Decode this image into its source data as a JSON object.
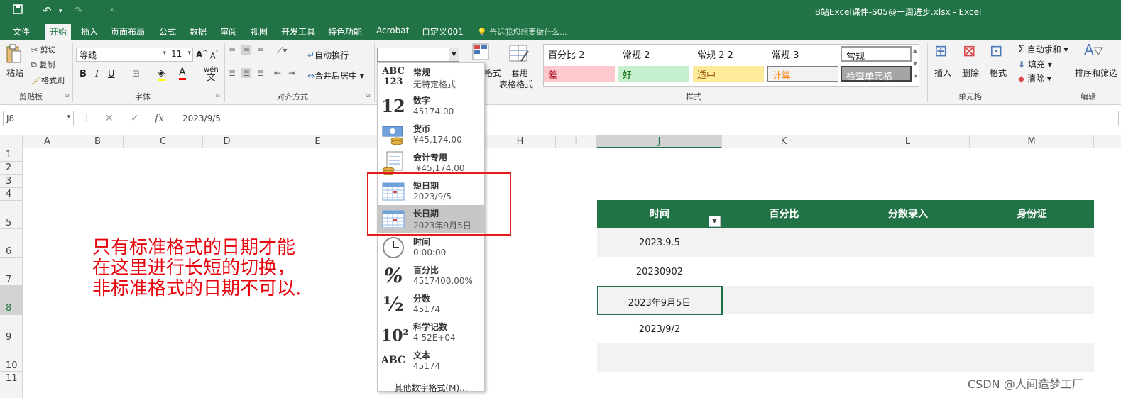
{
  "window": {
    "title": "B站Excel课件-S05@一周进步.xlsx - Excel"
  },
  "quick_access": {
    "save_icon": "save-icon",
    "undo_icon": "undo-icon",
    "redo_icon": "redo-icon",
    "customize_icon": "customize-icon"
  },
  "tabs": [
    "文件",
    "开始",
    "插入",
    "页面布局",
    "公式",
    "数据",
    "审阅",
    "视图",
    "开发工具",
    "特色功能",
    "Acrobat",
    "自定义001"
  ],
  "active_tab": "开始",
  "tell_me": "告诉我您想要做什么...",
  "clipboard": {
    "paste": "粘贴",
    "cut": "剪切",
    "copy": "复制",
    "format_painter": "格式刷",
    "label": "剪贴板"
  },
  "font": {
    "name": "等线",
    "size": "11",
    "bold": "B",
    "italic": "I",
    "underline": "U",
    "label": "字体",
    "phonetic": "wén"
  },
  "alignment": {
    "wrap": "自动换行",
    "merge": "合并后居中",
    "label": "对齐方式"
  },
  "number_format_combo": {
    "value": ""
  },
  "styles": {
    "conditional_partial": "格式",
    "table_format": [
      "套用",
      "表格格式"
    ],
    "items": [
      {
        "label": "百分比 2",
        "bg": "#ffffff",
        "fg": "#222222"
      },
      {
        "label": "常规 2",
        "bg": "#ffffff",
        "fg": "#222222"
      },
      {
        "label": "常规 2 2",
        "bg": "#ffffff",
        "fg": "#222222"
      },
      {
        "label": "常规 3",
        "bg": "#ffffff",
        "fg": "#222222"
      },
      {
        "label": "常规",
        "bg": "#ffffff",
        "fg": "#222222"
      },
      {
        "label": "差",
        "bg": "#ffc7ce",
        "fg": "#9c0006"
      },
      {
        "label": "好",
        "bg": "#c6efce",
        "fg": "#006100"
      },
      {
        "label": "适中",
        "bg": "#ffeb9c",
        "fg": "#9c5700"
      },
      {
        "label": "计算",
        "bg": "#f2f2f2",
        "fg": "#fa7d00"
      },
      {
        "label": "检查单元格",
        "bg": "#a5a5a5",
        "fg": "#ffffff"
      }
    ],
    "label": "样式"
  },
  "cells_group": {
    "insert": "插入",
    "delete": "删除",
    "format": "格式",
    "label": "单元格"
  },
  "editing": {
    "autosum": "自动求和",
    "fill": "填充",
    "clear": "清除",
    "sort": "排序和筛选",
    "label": "编辑"
  },
  "formula_bar": {
    "name_box": "J8",
    "formula": "2023/9/5"
  },
  "columns": [
    "A",
    "B",
    "C",
    "D",
    "E",
    "H",
    "I",
    "J",
    "K",
    "L",
    "M"
  ],
  "rows": [
    "1",
    "2",
    "3",
    "4",
    "5",
    "6",
    "7",
    "8",
    "9",
    "10",
    "11"
  ],
  "table": {
    "headers": [
      "时间",
      "百分比",
      "分数录入",
      "身份证"
    ],
    "values": [
      "2023.9.5",
      "20230902",
      "2023年9月5日",
      "2023/9/2",
      ""
    ]
  },
  "note": [
    "只有标准格式的日期才能",
    "在这里进行长短的切换，",
    "非标准格式的日期不可以."
  ],
  "dropdown": {
    "items": [
      {
        "icon": "ABC\n123",
        "name": "常规",
        "value": "无特定格式"
      },
      {
        "icon": "12",
        "name": "数字",
        "value": "45174.00"
      },
      {
        "icon": "currency-icon",
        "name": "货币",
        "value": "¥45,174.00"
      },
      {
        "icon": "accounting-icon",
        "name": "会计专用",
        "value": " ¥45,174.00"
      },
      {
        "icon": "calendar-icon",
        "name": "短日期",
        "value": "2023/9/5"
      },
      {
        "icon": "calendar-icon",
        "name": "长日期",
        "value": "2023年9月5日"
      },
      {
        "icon": "clock-icon",
        "name": "时间",
        "value": "0:00:00"
      },
      {
        "icon": "%",
        "name": "百分比",
        "value": "4517400.00%"
      },
      {
        "icon": "½",
        "name": "分数",
        "value": "45174"
      },
      {
        "icon": "10²",
        "name": "科学记数",
        "value": "4.52E+04"
      },
      {
        "icon": "ABC",
        "name": "文本",
        "value": "45174"
      }
    ],
    "more": "其他数字格式(M)...",
    "highlighted": "长日期"
  },
  "watermark": "CSDN @人间造梦工厂",
  "colors": {
    "excel_green": "#217346",
    "annotation_red": "#e8000b"
  }
}
